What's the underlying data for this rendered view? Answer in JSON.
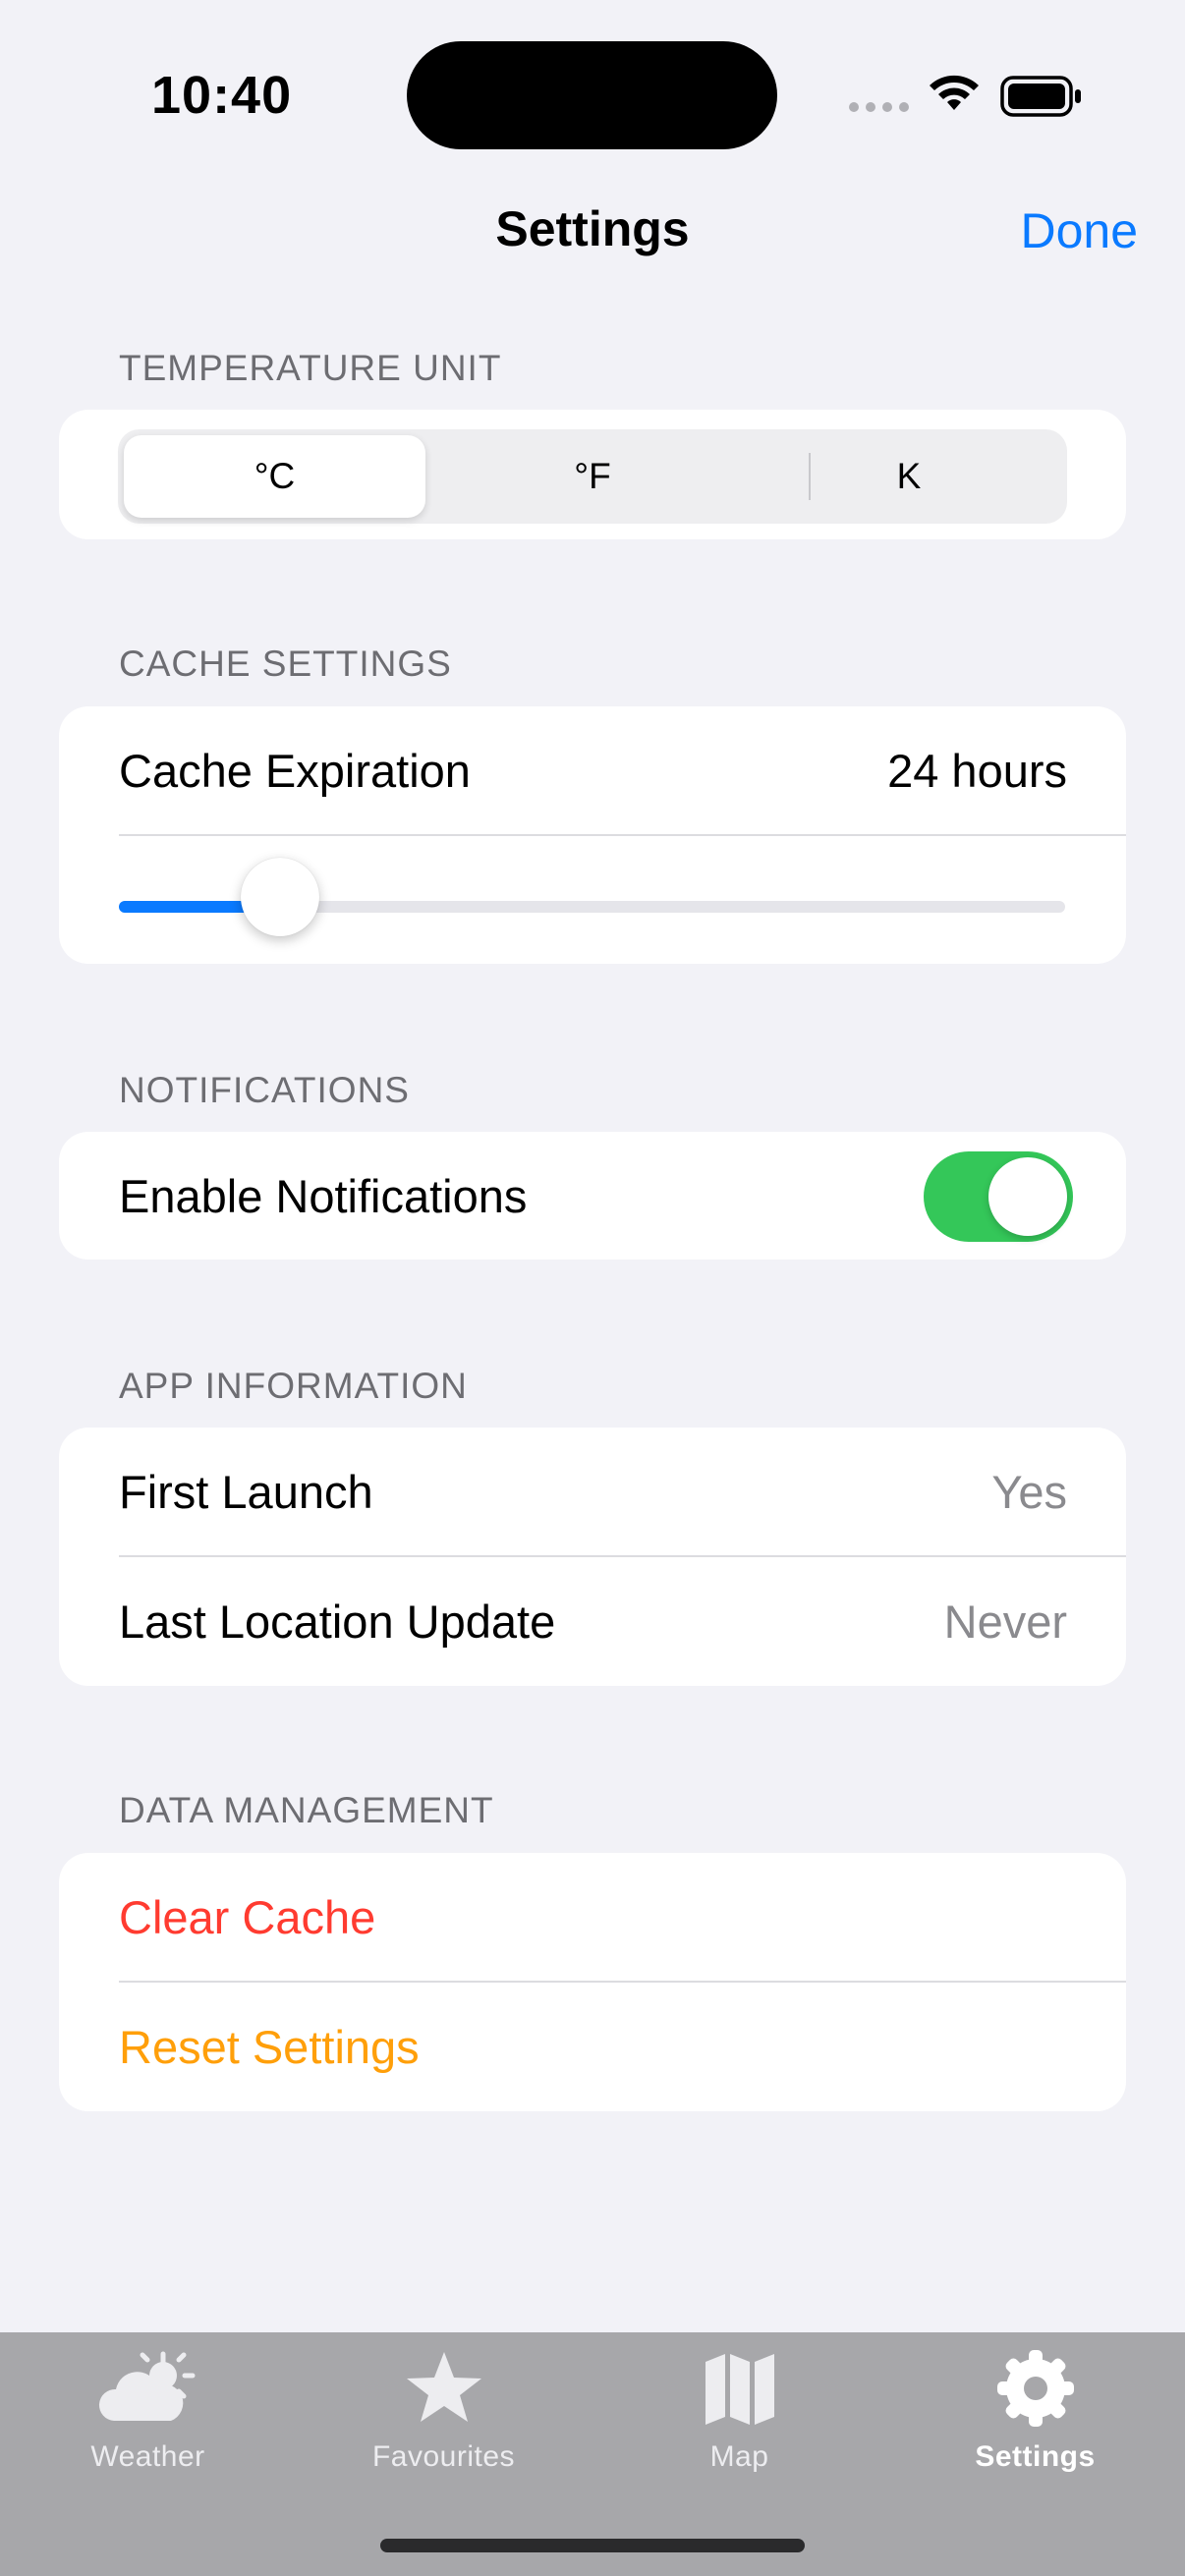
{
  "status_bar": {
    "time": "10:40"
  },
  "nav": {
    "title": "Settings",
    "done_label": "Done"
  },
  "temperature": {
    "header": "TEMPERATURE UNIT",
    "options": [
      "°C",
      "°F",
      "K"
    ],
    "selected": "°C"
  },
  "cache": {
    "header": "CACHE SETTINGS",
    "label": "Cache Expiration",
    "value": "24 hours",
    "slider_fraction": 0.17
  },
  "notifications": {
    "header": "NOTIFICATIONS",
    "label": "Enable Notifications",
    "enabled": true
  },
  "app_info": {
    "header": "APP INFORMATION",
    "rows": [
      {
        "label": "First Launch",
        "value": "Yes"
      },
      {
        "label": "Last Location Update",
        "value": "Never"
      }
    ]
  },
  "data_management": {
    "header": "DATA MANAGEMENT",
    "clear_label": "Clear Cache",
    "reset_label": "Reset Settings"
  },
  "colors": {
    "accent": "#0a7aff",
    "destructive": "#ff3b30",
    "warning": "#ff9f0a",
    "toggle_on": "#34c759"
  },
  "tabbar": {
    "tabs": [
      {
        "label": "Weather",
        "icon": "cloud-sun-icon"
      },
      {
        "label": "Favourites",
        "icon": "star-icon"
      },
      {
        "label": "Map",
        "icon": "map-icon"
      },
      {
        "label": "Settings",
        "icon": "gear-icon",
        "active": true
      }
    ]
  }
}
